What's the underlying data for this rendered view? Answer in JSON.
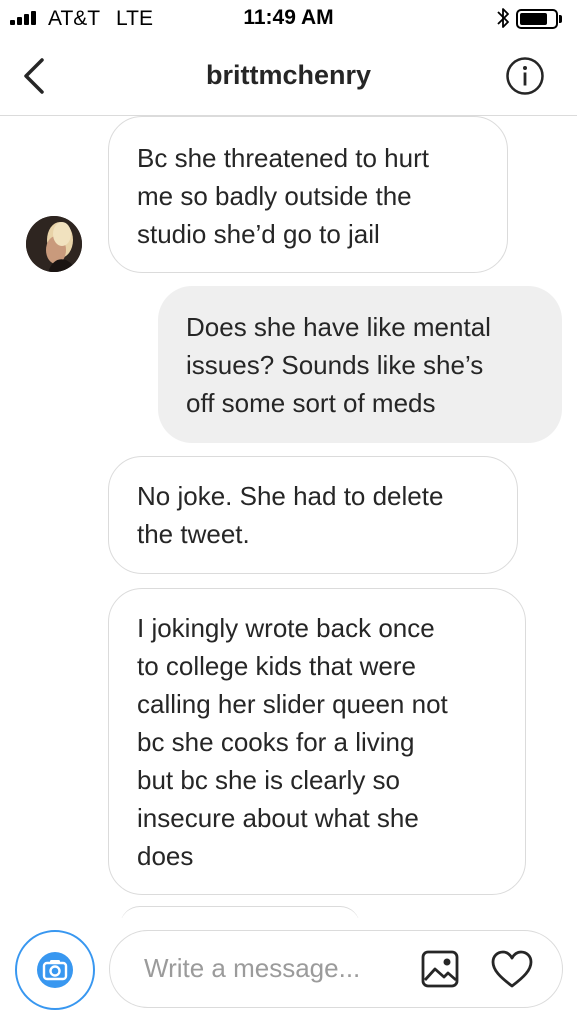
{
  "status_bar": {
    "carrier": "AT&T",
    "network": "LTE",
    "time": "11:49 AM",
    "signal_bars": 4,
    "battery_level": 0.8
  },
  "header": {
    "title": "brittmchenry",
    "back_icon": "chevron-left-icon",
    "info_icon": "info-icon"
  },
  "messages": [
    {
      "direction": "incoming",
      "text": "Bc she threatened to hurt\nme so badly outside the\nstudio she’d go to jail"
    },
    {
      "direction": "outgoing",
      "text": "Does she have like mental\nissues? Sounds like she’s\noff some sort of meds"
    },
    {
      "direction": "incoming",
      "text": "No joke. She had to delete\nthe tweet."
    },
    {
      "direction": "incoming",
      "text": "I jokingly wrote back once\nto college kids that were\ncalling her slider queen not\nbc she cooks for a living\nbut bc she is clearly so\ninsecure about what she\ndoes"
    }
  ],
  "composer": {
    "placeholder": "Write a message...",
    "camera_icon": "camera-icon",
    "gallery_icon": "image-icon",
    "like_icon": "heart-icon"
  },
  "colors": {
    "accent": "#3897f0",
    "bubble_border": "#dbdbdb",
    "outgoing_bubble": "#efefef",
    "text": "#262626",
    "placeholder": "#9b9b9b"
  }
}
